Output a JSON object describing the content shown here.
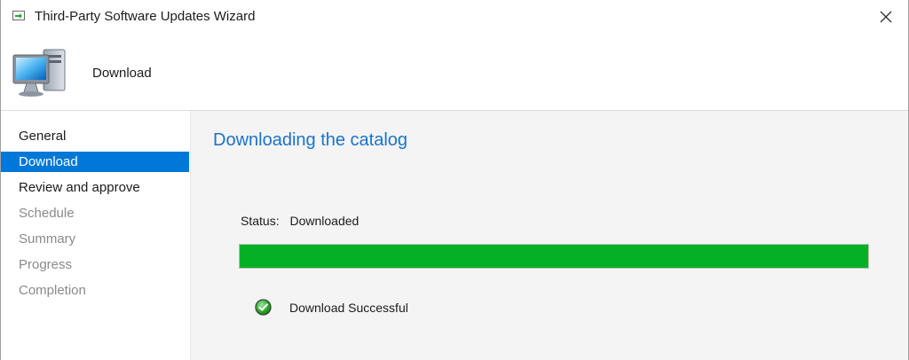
{
  "window": {
    "title": "Third-Party Software Updates Wizard"
  },
  "header": {
    "title": "Download",
    "icon": "computer-icon"
  },
  "sidebar": {
    "items": [
      {
        "label": "General",
        "state": "enabled"
      },
      {
        "label": "Download",
        "state": "active"
      },
      {
        "label": "Review and approve",
        "state": "enabled"
      },
      {
        "label": "Schedule",
        "state": "disabled"
      },
      {
        "label": "Summary",
        "state": "disabled"
      },
      {
        "label": "Progress",
        "state": "disabled"
      },
      {
        "label": "Completion",
        "state": "disabled"
      }
    ]
  },
  "main": {
    "heading": "Downloading the catalog",
    "status_label": "Status:",
    "status_value": "Downloaded",
    "progress_percent": 100,
    "result_text": "Download Successful",
    "result_icon": "check-circle-icon"
  },
  "colors": {
    "accent": "#0078d7",
    "heading": "#1a73c9",
    "progress": "#06b025",
    "panel_bg": "#f4f4f4"
  }
}
